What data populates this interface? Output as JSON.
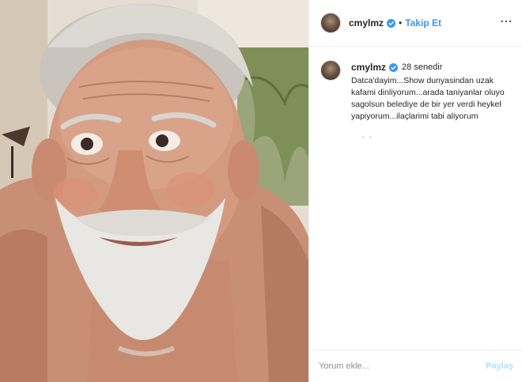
{
  "post": {
    "username": "cmylmz",
    "verified_icon": "verified-badge-icon",
    "follow_label": "Takip Et",
    "more_icon": "more-options-icon",
    "separator": "•"
  },
  "caption": {
    "username": "cmylmz",
    "time": "28 senedir",
    "text": "Datca'dayim...Show dunyasindan uzak kafami dinliyorum...arada taniyanlar oluyo sagolsun belediye de bir yer verdi heykel yapiyorum...ilaçlarimi tabi aliyorum",
    "loading": "• •"
  },
  "comment_box": {
    "placeholder": "Yorum ekle...",
    "share_label": "Paylaş"
  },
  "colors": {
    "link": "#3897f0",
    "share_disabled": "#b2dffc",
    "verified": "#3897f0"
  }
}
